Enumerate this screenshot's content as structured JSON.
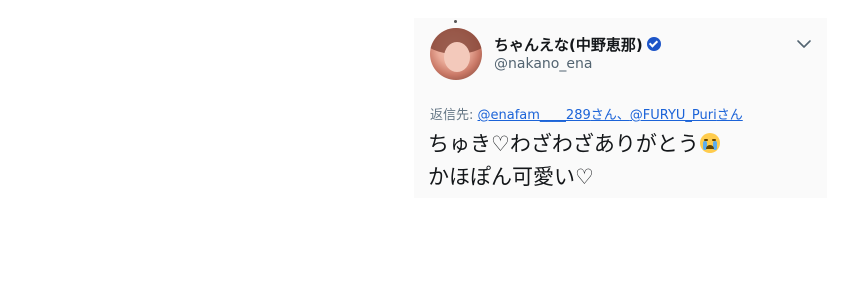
{
  "tweet": {
    "display_name": "ちゃんえな(中野恵那)",
    "handle": "@nakano_ena",
    "verified_icon": "verified-badge-icon",
    "menu_icon": "chevron-down-icon",
    "reply_to": {
      "prefix": "返信先: ",
      "mention_1": "@enafam____289",
      "suffix_1": "さん、",
      "mention_2": "@FURYU_Puri",
      "suffix_2": "さん"
    },
    "text_line_1": "ちゅき♡わざわざありがとう",
    "emoji": "loudly-crying-face-emoji",
    "text_line_2": "かほぽん可愛い♡"
  },
  "colors": {
    "link": "#1b63d8",
    "verified": "#1d55c8",
    "secondary_text": "#657786",
    "primary_text": "#14171a"
  }
}
